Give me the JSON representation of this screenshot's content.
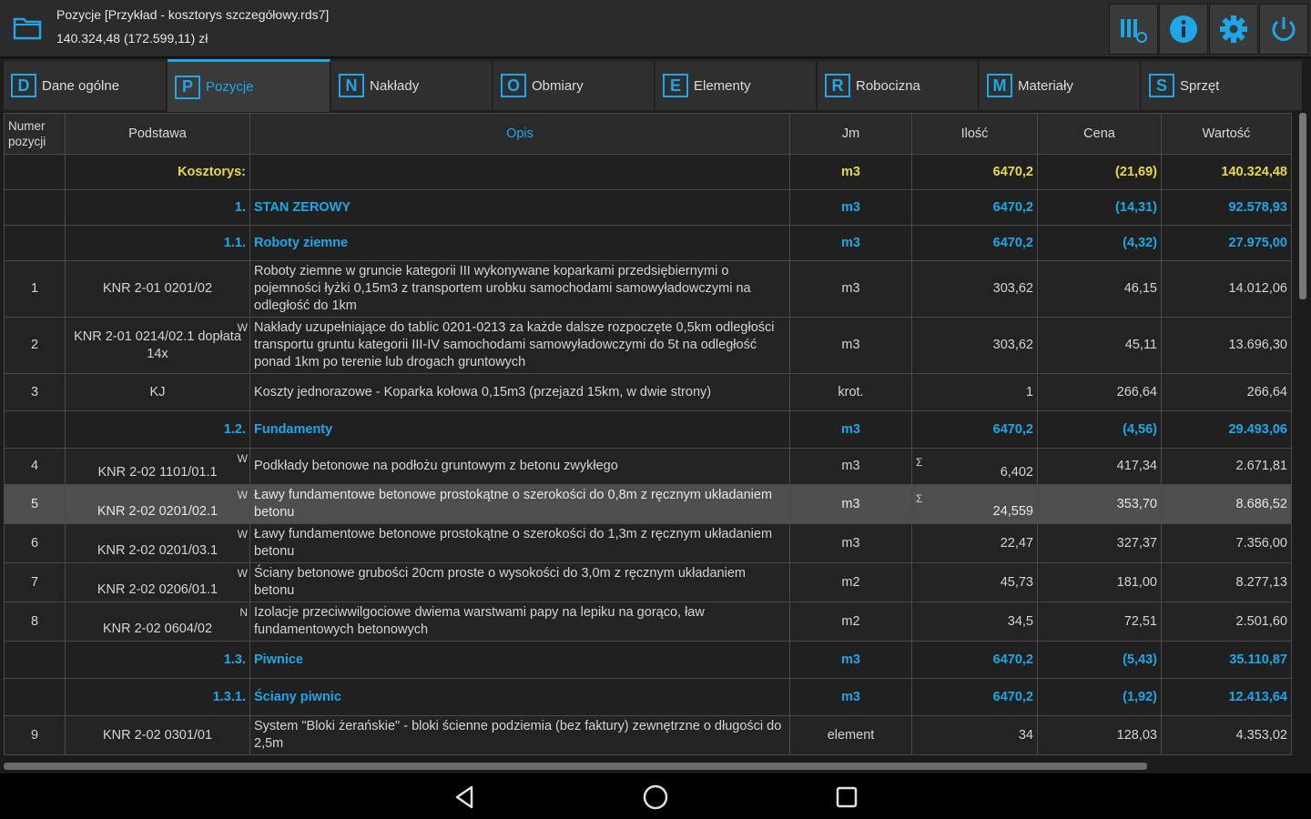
{
  "header": {
    "title": "Pozycje [Przykład - kosztorys szczegółowy.rds7]",
    "subtitle": "140.324,48 (172.599,11) zł",
    "buttons": [
      "columns-settings-icon",
      "info-icon",
      "gear-icon",
      "power-icon"
    ]
  },
  "colors": {
    "accent": "#1ea7e8",
    "summary_yellow": "#e7d84a",
    "selected_row": "#4e4e4e"
  },
  "tabs": [
    {
      "key": "D",
      "label": "Dane ogólne"
    },
    {
      "key": "P",
      "label": "Pozycje"
    },
    {
      "key": "N",
      "label": "Nakłady"
    },
    {
      "key": "O",
      "label": "Obmiary"
    },
    {
      "key": "E",
      "label": "Elementy"
    },
    {
      "key": "R",
      "label": "Robocizna"
    },
    {
      "key": "M",
      "label": "Materiały"
    },
    {
      "key": "S",
      "label": "Sprzęt"
    }
  ],
  "table": {
    "headers": [
      "Numer pozycji",
      "Podstawa",
      "Opis",
      "Jm",
      "Ilość",
      "Cena",
      "Wartość"
    ],
    "rows": [
      {
        "num": "",
        "podstawa": "Kosztorys:",
        "flag": "",
        "opis": "",
        "jm": "m3",
        "sig": "",
        "ilosc": "6470,2",
        "cena": "(21,69)",
        "wartosc": "140.324,48"
      },
      {
        "num": "",
        "podstawa": "1.",
        "flag": "",
        "opis": "STAN ZEROWY",
        "jm": "m3",
        "sig": "",
        "ilosc": "6470,2",
        "cena": "(14,31)",
        "wartosc": "92.578,93"
      },
      {
        "num": "",
        "podstawa": "1.1.",
        "flag": "",
        "opis": "Roboty ziemne",
        "jm": "m3",
        "sig": "",
        "ilosc": "6470,2",
        "cena": "(4,32)",
        "wartosc": "27.975,00"
      },
      {
        "num": "1",
        "podstawa": "KNR 2-01 0201/02",
        "flag": "",
        "opis": "Roboty ziemne w gruncie kategorii III wykonywane koparkami przedsiębiernymi o pojemności łyżki 0,15m3 z transportem urobku samochodami samowyładowczymi na odległość do 1km",
        "jm": "m3",
        "sig": "",
        "ilosc": "303,62",
        "cena": "46,15",
        "wartosc": "14.012,06"
      },
      {
        "num": "2",
        "podstawa": "KNR 2-01 0214/02.1 dopłata 14x",
        "flag": "W",
        "opis": "Nakłady uzupełniające do tablic 0201-0213 za każde dalsze rozpoczęte 0,5km odległości transportu gruntu kategorii III-IV samochodami samowyładowczymi do 5t na odległość ponad 1km po terenie lub drogach gruntowych",
        "jm": "m3",
        "sig": "",
        "ilosc": "303,62",
        "cena": "45,11",
        "wartosc": "13.696,30"
      },
      {
        "num": "3",
        "podstawa": "KJ",
        "flag": "",
        "opis": "Koszty jednorazowe - Koparka kołowa 0,15m3 (przejazd 15km, w dwie strony)",
        "jm": "krot.",
        "sig": "",
        "ilosc": "1",
        "cena": "266,64",
        "wartosc": "266,64"
      },
      {
        "num": "",
        "podstawa": "1.2.",
        "flag": "",
        "opis": "Fundamenty",
        "jm": "m3",
        "sig": "",
        "ilosc": "6470,2",
        "cena": "(4,56)",
        "wartosc": "29.493,06"
      },
      {
        "num": "4",
        "podstawa": "KNR 2-02 1101/01.1",
        "flag": "W",
        "opis": "Podkłady betonowe na podłożu gruntowym z betonu zwykłego",
        "jm": "m3",
        "sig": "Σ",
        "ilosc": "6,402",
        "cena": "417,34",
        "wartosc": "2.671,81"
      },
      {
        "num": "5",
        "podstawa": "KNR 2-02 0201/02.1",
        "flag": "W",
        "opis": "Ławy fundamentowe betonowe prostokątne o szerokości do 0,8m z ręcznym układaniem betonu",
        "jm": "m3",
        "sig": "Σ",
        "ilosc": "24,559",
        "cena": "353,70",
        "wartosc": "8.686,52"
      },
      {
        "num": "6",
        "podstawa": "KNR 2-02 0201/03.1",
        "flag": "W",
        "opis": "Ławy fundamentowe betonowe prostokątne o szerokości do 1,3m z ręcznym układaniem betonu",
        "jm": "m3",
        "sig": "",
        "ilosc": "22,47",
        "cena": "327,37",
        "wartosc": "7.356,00"
      },
      {
        "num": "7",
        "podstawa": "KNR 2-02 0206/01.1",
        "flag": "W",
        "opis": "Ściany betonowe grubości 20cm proste o wysokości do 3,0m z ręcznym układaniem betonu",
        "jm": "m2",
        "sig": "",
        "ilosc": "45,73",
        "cena": "181,00",
        "wartosc": "8.277,13"
      },
      {
        "num": "8",
        "podstawa": "KNR 2-02 0604/02",
        "flag": "N",
        "opis": "Izolacje przeciwwilgociowe dwiema warstwami papy na lepiku na gorąco, ław fundamentowych betonowych",
        "jm": "m2",
        "sig": "",
        "ilosc": "34,5",
        "cena": "72,51",
        "wartosc": "2.501,60"
      },
      {
        "num": "",
        "podstawa": "1.3.",
        "flag": "",
        "opis": "Piwnice",
        "jm": "m3",
        "sig": "",
        "ilosc": "6470,2",
        "cena": "(5,43)",
        "wartosc": "35.110,87"
      },
      {
        "num": "",
        "podstawa": "1.3.1.",
        "flag": "",
        "opis": "Ściany piwnic",
        "jm": "m3",
        "sig": "",
        "ilosc": "6470,2",
        "cena": "(1,92)",
        "wartosc": "12.413,64"
      },
      {
        "num": "9",
        "podstawa": "KNR 2-02 0301/01",
        "flag": "",
        "opis": "System \"Bloki żerańskie\" - bloki ścienne podziemia (bez faktury) zewnętrzne o długości do 2,5m",
        "jm": "element",
        "sig": "",
        "ilosc": "34",
        "cena": "128,03",
        "wartosc": "4.353,02"
      }
    ]
  }
}
